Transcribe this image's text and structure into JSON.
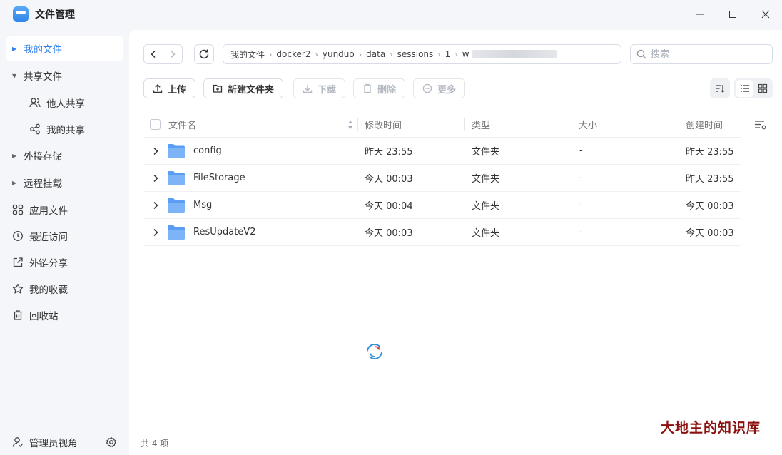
{
  "window": {
    "title": "文件管理"
  },
  "sidebar": {
    "items": [
      {
        "label": "我的文件"
      },
      {
        "label": "共享文件"
      },
      {
        "label": "他人共享"
      },
      {
        "label": "我的共享"
      },
      {
        "label": "外接存储"
      },
      {
        "label": "远程挂载"
      },
      {
        "label": "应用文件"
      },
      {
        "label": "最近访问"
      },
      {
        "label": "外链分享"
      },
      {
        "label": "我的收藏"
      },
      {
        "label": "回收站"
      }
    ],
    "footer_label": "管理员视角"
  },
  "breadcrumb": [
    "我的文件",
    "docker2",
    "yunduo",
    "data",
    "sessions",
    "1",
    "w"
  ],
  "search": {
    "placeholder": "搜索"
  },
  "toolbar": {
    "upload": "上传",
    "new_folder": "新建文件夹",
    "download": "下载",
    "delete": "删除",
    "more": "更多"
  },
  "table": {
    "columns": [
      "文件名",
      "修改时间",
      "类型",
      "大小",
      "创建时间"
    ],
    "rows": [
      {
        "name": "config",
        "modified": "昨天 23:55",
        "type": "文件夹",
        "size": "-",
        "created": "昨天 23:55"
      },
      {
        "name": "FileStorage",
        "modified": "今天 00:03",
        "type": "文件夹",
        "size": "-",
        "created": "昨天 23:55"
      },
      {
        "name": "Msg",
        "modified": "今天 00:04",
        "type": "文件夹",
        "size": "-",
        "created": "今天 00:03"
      },
      {
        "name": "ResUpdateV2",
        "modified": "今天 00:03",
        "type": "文件夹",
        "size": "-",
        "created": "今天 00:03"
      }
    ]
  },
  "status": {
    "count": "共 4 项"
  },
  "watermark": "大地主的知识库",
  "colors": {
    "accent": "#2f7ff0",
    "folder": "#6aa9f6"
  }
}
